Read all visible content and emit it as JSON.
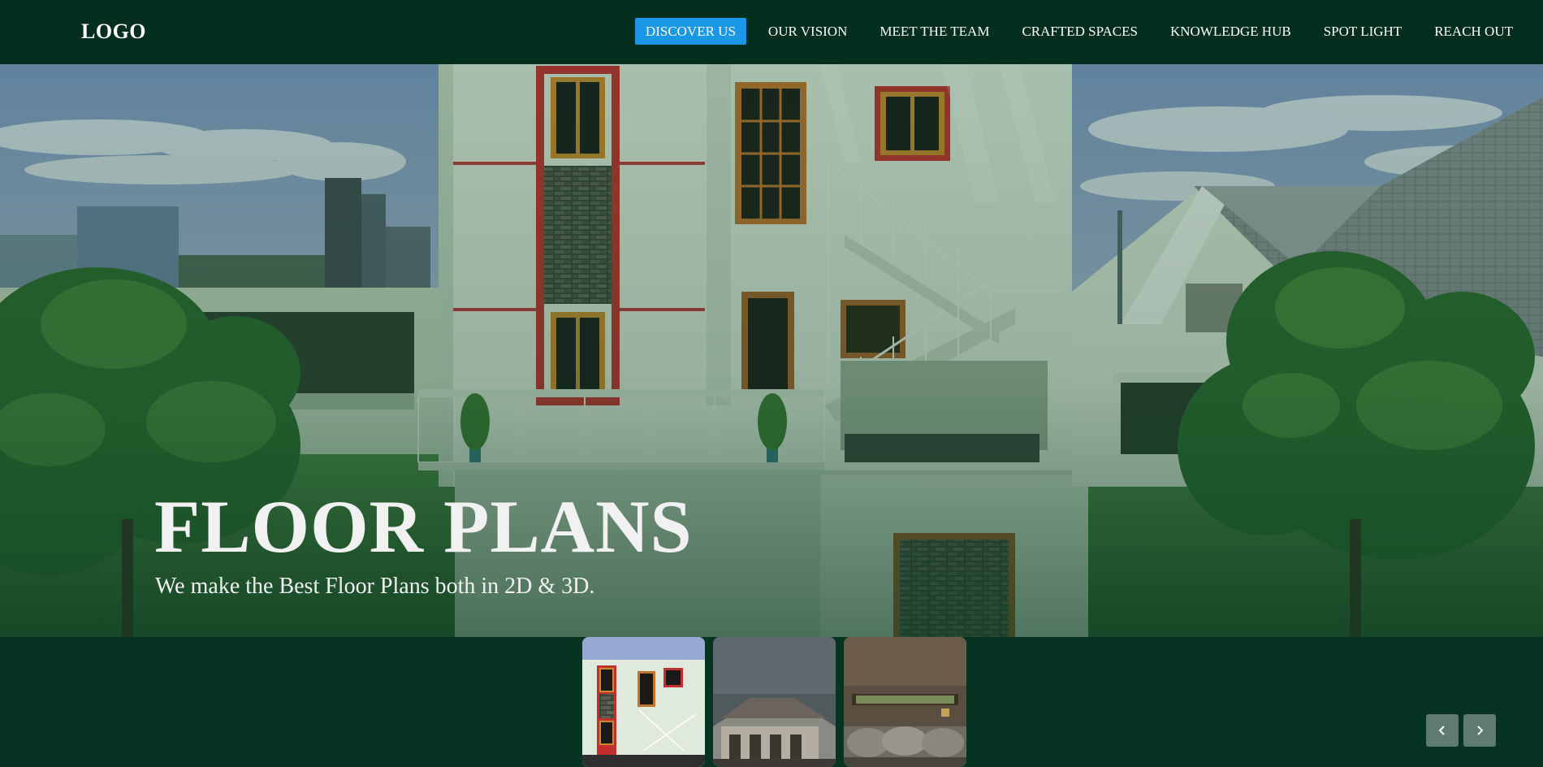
{
  "header": {
    "logo": "LOGO",
    "nav": [
      {
        "label": "DISCOVER US",
        "active": true
      },
      {
        "label": "OUR VISION",
        "active": false
      },
      {
        "label": "MEET THE TEAM",
        "active": false
      },
      {
        "label": "CRAFTED SPACES",
        "active": false
      },
      {
        "label": "KNOWLEDGE HUB",
        "active": false
      },
      {
        "label": "SPOT LIGHT",
        "active": false
      },
      {
        "label": "REACH OUT",
        "active": false
      }
    ]
  },
  "hero": {
    "title": "FLOOR PLANS",
    "subtitle": "We make the Best Floor Plans both in 2D & 3D."
  },
  "carousel": {
    "thumbnails": [
      {
        "name": "thumbnail-house-exterior",
        "selected": true
      },
      {
        "name": "thumbnail-stone-villa",
        "selected": false
      },
      {
        "name": "thumbnail-living-room",
        "selected": false
      }
    ],
    "controls": {
      "prev_icon": "chevron-left-icon",
      "next_icon": "chevron-right-icon"
    }
  },
  "colors": {
    "header_bg": "#022e1d",
    "page_bg": "#063322",
    "active_nav": "#1a97e6",
    "arrow_bg": "#5e7a72"
  }
}
